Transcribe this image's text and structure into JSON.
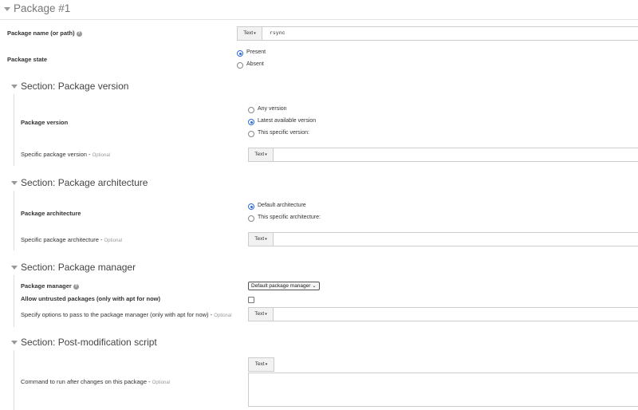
{
  "package": {
    "title": "Package #1"
  },
  "package_name": {
    "label": "Package name (or path)",
    "type_label": "Text",
    "value": "rsync"
  },
  "package_state": {
    "label": "Package state",
    "options": [
      "Present",
      "Absent"
    ],
    "selected": "Present"
  },
  "sections": {
    "version": {
      "title": "Section: Package version",
      "field_label": "Package version",
      "options": [
        "Any version",
        "Latest available version",
        "This specific version:"
      ],
      "selected": "Latest available version",
      "specific_label": "Specific package version",
      "optional": "Optional",
      "type_label": "Text"
    },
    "architecture": {
      "title": "Section: Package architecture",
      "field_label": "Package architecture",
      "options": [
        "Default architecture",
        "This specific architecture:"
      ],
      "selected": "Default architecture",
      "specific_label": "Specific package architecture",
      "optional": "Optional",
      "type_label": "Text"
    },
    "manager": {
      "title": "Section: Package manager",
      "manager_label": "Package manager",
      "manager_value": "Default package manager",
      "untrusted_label": "Allow untrusted packages (only with apt for now)",
      "untrusted_checked": false,
      "options_label": "Specify options to pass to the package manager (only with apt for now)",
      "optional": "Optional",
      "type_label": "Text"
    },
    "post": {
      "title": "Section: Post-modification script",
      "command_label": "Command to run after changes on this package",
      "optional": "Optional",
      "type_label": "Text"
    }
  },
  "separator": " - ",
  "icons": {
    "caret": "caret-down-icon",
    "help": "help-icon",
    "dropdown": "dropdown-arrow-icon"
  },
  "colors": {
    "radio_selected": "#2b6bd6",
    "header_text": "#777777",
    "optional_text": "#999999"
  }
}
